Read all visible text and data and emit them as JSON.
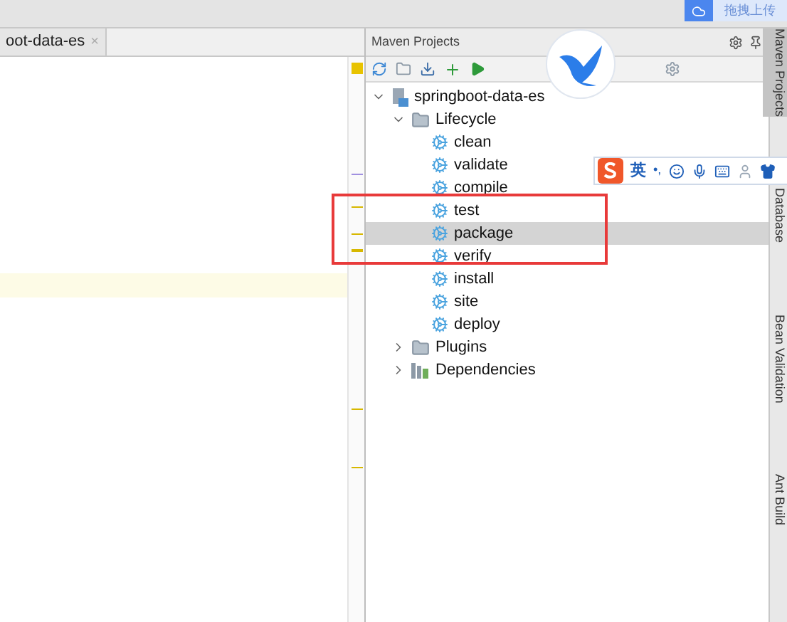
{
  "upload_button": {
    "label": "拖拽上传"
  },
  "editor_tab": {
    "title": "oot-data-es",
    "close": "×"
  },
  "maven": {
    "title": "Maven Projects",
    "tree": [
      {
        "label": "springboot-data-es",
        "kind": "project",
        "expanded": true,
        "selected": false,
        "children": [
          {
            "label": "Lifecycle",
            "kind": "folder",
            "expanded": true,
            "selected": false,
            "children": [
              {
                "label": "clean",
                "kind": "goal",
                "selected": false
              },
              {
                "label": "validate",
                "kind": "goal",
                "selected": false
              },
              {
                "label": "compile",
                "kind": "goal",
                "selected": false
              },
              {
                "label": "test",
                "kind": "goal",
                "selected": false
              },
              {
                "label": "package",
                "kind": "goal",
                "selected": true
              },
              {
                "label": "verify",
                "kind": "goal",
                "selected": false
              },
              {
                "label": "install",
                "kind": "goal",
                "selected": false
              },
              {
                "label": "site",
                "kind": "goal",
                "selected": false
              },
              {
                "label": "deploy",
                "kind": "goal",
                "selected": false
              }
            ]
          },
          {
            "label": "Plugins",
            "kind": "folder",
            "expanded": false,
            "selected": false
          },
          {
            "label": "Dependencies",
            "kind": "deps",
            "expanded": false,
            "selected": false
          }
        ]
      }
    ]
  },
  "ime_toolbar": {
    "language": "英",
    "punctuation": "•,"
  },
  "side_tabs": [
    {
      "label": "Maven Projects",
      "selected": true
    },
    {
      "label": "Database",
      "selected": false
    },
    {
      "label": "Bean Validation",
      "selected": false
    },
    {
      "label": "Ant Build",
      "selected": false
    }
  ]
}
